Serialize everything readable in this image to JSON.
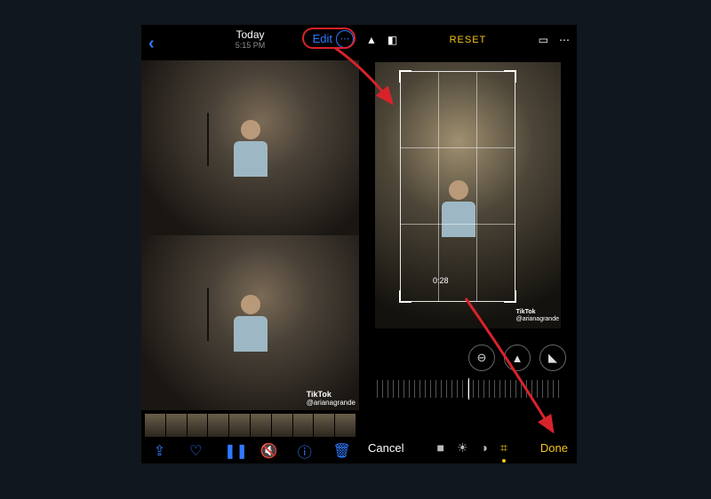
{
  "left": {
    "title": "Today",
    "subtitle": "5:15 PM",
    "edit_label": "Edit",
    "more_glyph": "⋯",
    "watermark_brand": "TikTok",
    "watermark_handle": "@arianagrande",
    "toolbar": {
      "share": "⇪",
      "like": "♡",
      "pause": "❚❚",
      "mute": "🔇",
      "info": "ⓘ",
      "trash": "🗑"
    }
  },
  "right": {
    "reset_label": "RESET",
    "time_label": "0:28",
    "watermark_brand": "TikTok",
    "watermark_handle": "@arianagrande",
    "cancel_label": "Cancel",
    "done_label": "Done",
    "top_icons": {
      "flip_v": "▲",
      "flip_copy": "◧",
      "aspect": "▭",
      "more": "⋯"
    },
    "rotate_icons": {
      "a": "⊖",
      "b": "▲",
      "c": "◣"
    },
    "tool_icons": {
      "video": "■",
      "adjust": "☀",
      "filters": "◑",
      "crop": "⌗"
    }
  }
}
